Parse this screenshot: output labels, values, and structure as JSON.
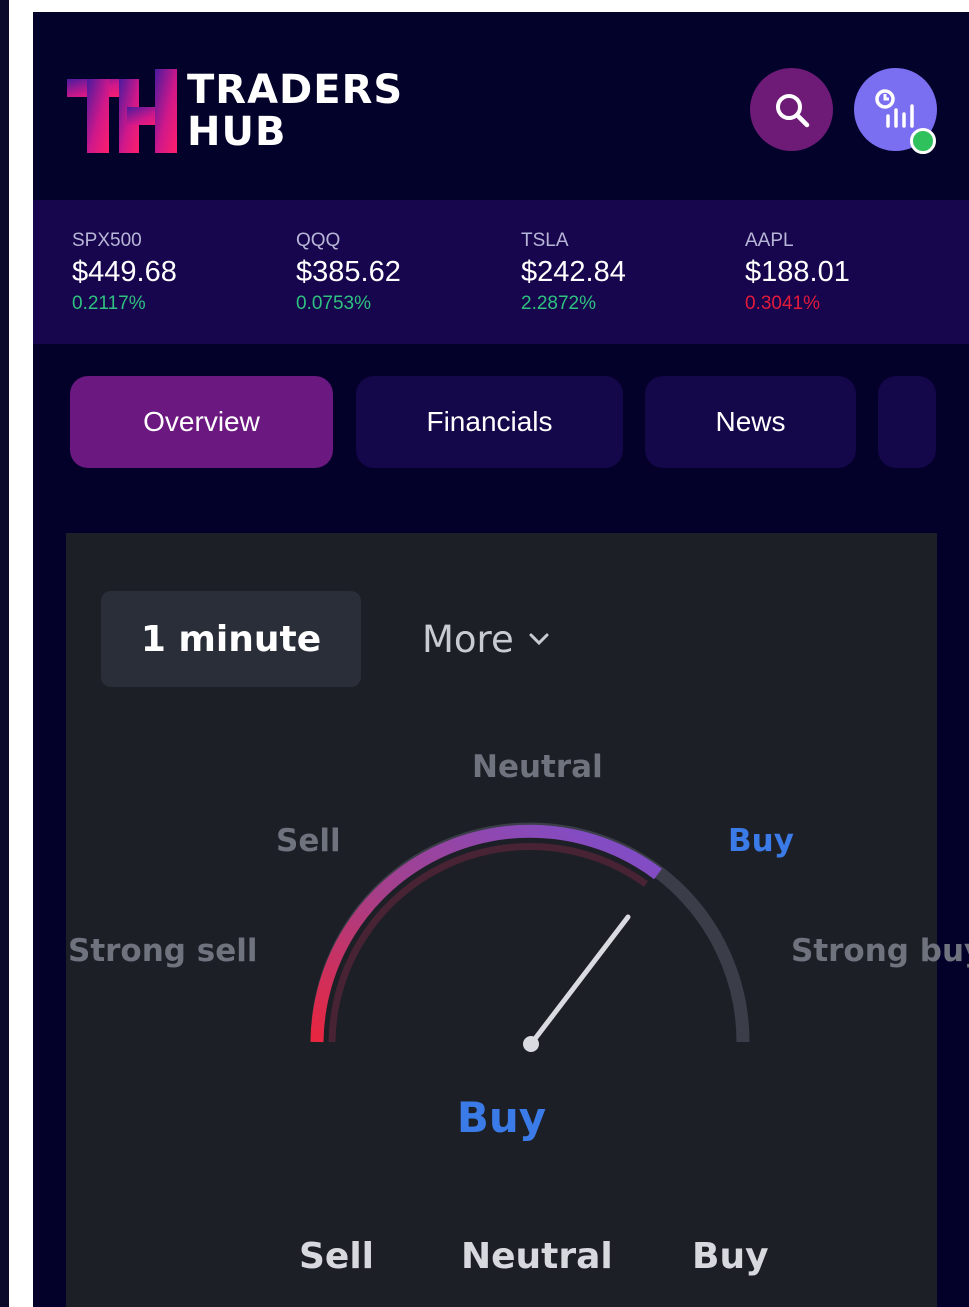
{
  "app": {
    "logo_line1": "TRADERS",
    "logo_line2": "HUB",
    "logo_mark": "TH"
  },
  "header": {
    "search_icon": "search-icon",
    "chart_icon": "chart-profile-icon",
    "online_status_color": "#2fc15b"
  },
  "ticker": [
    {
      "symbol": "SPX500",
      "price": "$449.68",
      "change": "0.2117%",
      "direction": "up"
    },
    {
      "symbol": "QQQ",
      "price": "$385.62",
      "change": "0.0753%",
      "direction": "up"
    },
    {
      "symbol": "TSLA",
      "price": "$242.84",
      "change": "2.2872%",
      "direction": "up"
    },
    {
      "symbol": "AAPL",
      "price": "$188.01",
      "change": "0.3041%",
      "direction": "down"
    }
  ],
  "tabs": [
    {
      "label": "Overview",
      "active": true
    },
    {
      "label": "Financials",
      "active": false
    },
    {
      "label": "News",
      "active": false
    },
    {
      "label": "",
      "active": false
    }
  ],
  "widget": {
    "interval_label": "1 minute",
    "more_label": "More",
    "gauge": {
      "labels": {
        "strong_sell": "Strong sell",
        "sell": "Sell",
        "neutral": "Neutral",
        "buy": "Buy",
        "strong_buy": "Strong buy"
      },
      "active": "Buy",
      "needle_value": 0.72
    },
    "result": "Buy",
    "summary_labels": [
      "Sell",
      "Neutral",
      "Buy"
    ]
  },
  "colors": {
    "accent_purple": "#6b1880",
    "buy_blue": "#3a7be8",
    "up_green": "#2fc17f",
    "down_red": "#e21b3c",
    "app_bg": "#03012a",
    "panel_bg": "#1d1f27"
  }
}
